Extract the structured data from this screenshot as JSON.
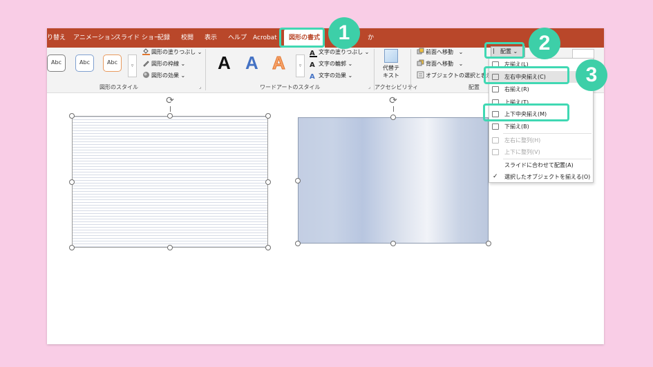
{
  "ribbon": {
    "tabs": [
      {
        "label": "り替え"
      },
      {
        "label": "アニメーション"
      },
      {
        "label": "スライド ショー"
      },
      {
        "label": "記録"
      },
      {
        "label": "校閲"
      },
      {
        "label": "表示"
      },
      {
        "label": "ヘルプ"
      },
      {
        "label": "Acrobat"
      },
      {
        "label": "図形の書式",
        "active": true
      },
      {
        "label": "か"
      }
    ],
    "shape_styles": {
      "thumbnails": [
        "Abc",
        "Abc",
        "Abc"
      ],
      "fill": "図形の塗りつぶし",
      "outline": "図形の枠線",
      "effects": "図形の効果",
      "group_label": "図形のスタイル"
    },
    "wordart": {
      "letters": [
        "A",
        "A",
        "A"
      ],
      "text_fill": "文字の塗りつぶし",
      "text_outline": "文字の輪郭",
      "text_effects": "文字の効果",
      "group_label": "ワードアートのスタイル"
    },
    "accessibility": {
      "alt_text_line1": "代替テ",
      "alt_text_line2": "キスト",
      "group_label": "アクセシビリティ"
    },
    "arrange": {
      "bring_forward": "前面へ移動",
      "send_backward": "背面へ移動",
      "selection_pane": "オブジェクトの選択と表示",
      "align_button": "配置",
      "group_label": "配置"
    }
  },
  "align_menu": {
    "items": [
      {
        "label": "左揃え(L)",
        "disabled": false,
        "highlighted": false
      },
      {
        "label": "左右中央揃え(C)",
        "disabled": false,
        "highlighted": true
      },
      {
        "label": "右揃え(R)",
        "disabled": false,
        "highlighted": false
      },
      {
        "label": "上揃え(T)",
        "disabled": false,
        "highlighted": false
      },
      {
        "label": "上下中央揃え(M)",
        "disabled": false,
        "highlighted": false
      },
      {
        "label": "下揃え(B)",
        "disabled": false,
        "highlighted": false
      },
      {
        "label": "左右に整列(H)",
        "disabled": true,
        "highlighted": false
      },
      {
        "label": "上下に整列(V)",
        "disabled": true,
        "highlighted": false
      },
      {
        "label": "スライドに合わせて配置(A)",
        "disabled": false,
        "highlighted": false
      },
      {
        "label": "選択したオブジェクトを揃える(O)",
        "disabled": false,
        "highlighted": false,
        "checked": true
      }
    ]
  },
  "callouts": [
    "1",
    "2",
    "3"
  ],
  "colors": {
    "background": "#f9cde6",
    "tab_bar": "#b9472a",
    "callout": "#3dcfa8",
    "callout_outline": "#40d8b3",
    "shape_fill": "#c3cee3"
  },
  "icons": [
    "rotate-handle-icon",
    "fill-bucket-icon",
    "pen-outline-icon",
    "effects-icon",
    "picture-icon",
    "bring-forward-icon",
    "send-backward-icon",
    "selection-pane-icon",
    "align-icon",
    "checkmark-icon"
  ]
}
